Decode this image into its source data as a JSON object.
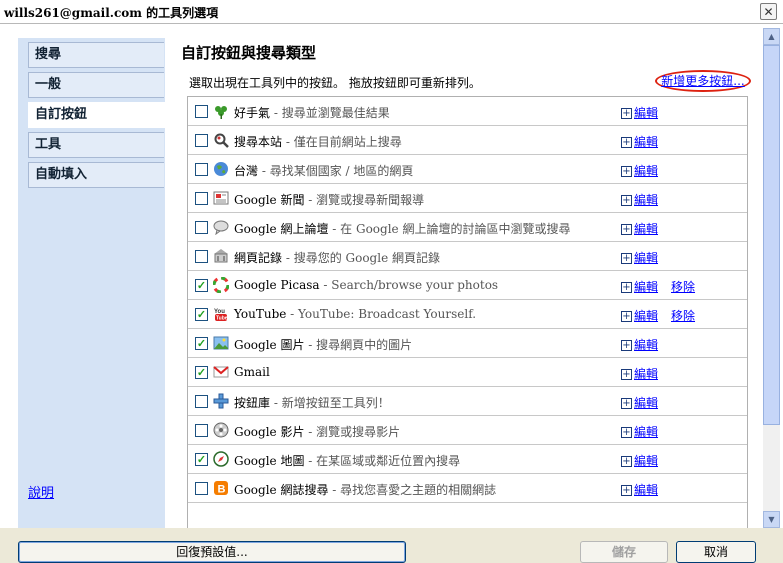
{
  "window": {
    "title": "wills261@gmail.com 的工具列選項",
    "close_glyph": "✕"
  },
  "sidebar": {
    "items": [
      {
        "label": "搜尋"
      },
      {
        "label": "一般"
      },
      {
        "label": "自訂按鈕"
      },
      {
        "label": "工具"
      },
      {
        "label": "自動填入"
      }
    ],
    "active_index": 2,
    "help_label": "說明"
  },
  "main": {
    "heading": "自訂按鈕與搜尋類型",
    "instruction": "選取出現在工具列中的按鈕。 拖放按鈕即可重新排列。",
    "add_more_label": "新增更多按鈕...",
    "edit_label": "編輯",
    "remove_label": "移除",
    "buttons": [
      {
        "name": "好手氣",
        "desc": "搜尋並瀏覽最佳結果",
        "checked": false,
        "icon": "clover-icon",
        "removable": false
      },
      {
        "name": "搜尋本站",
        "desc": "僅在目前網站上搜尋",
        "checked": false,
        "icon": "magnifier-icon",
        "removable": false
      },
      {
        "name": "台灣",
        "desc": "尋找某個國家 / 地區的網頁",
        "checked": false,
        "icon": "globe-icon",
        "removable": false
      },
      {
        "name": "Google 新聞",
        "desc": "瀏覽或搜尋新聞報導",
        "checked": false,
        "icon": "newspaper-icon",
        "removable": false
      },
      {
        "name": "Google 網上論壇",
        "desc": "在 Google 網上論壇的討論區中瀏覽或搜尋",
        "checked": false,
        "icon": "chat-bubble-icon",
        "removable": false
      },
      {
        "name": "網頁記錄",
        "desc": "搜尋您的 Google 網頁記錄",
        "checked": false,
        "icon": "history-building-icon",
        "removable": false
      },
      {
        "name": "Google Picasa",
        "desc": "Search/browse your photos",
        "checked": true,
        "icon": "picasa-icon",
        "removable": true
      },
      {
        "name": "YouTube",
        "desc": "YouTube: Broadcast Yourself.",
        "checked": true,
        "icon": "youtube-icon",
        "removable": true
      },
      {
        "name": "Google 圖片",
        "desc": "搜尋網頁中的圖片",
        "checked": true,
        "icon": "picture-icon",
        "removable": false
      },
      {
        "name": "Gmail",
        "desc": "",
        "checked": true,
        "icon": "gmail-icon",
        "removable": false
      },
      {
        "name": "按鈕庫",
        "desc": "新增按鈕至工具列！",
        "checked": false,
        "icon": "plus-blue-icon",
        "removable": false
      },
      {
        "name": "Google 影片",
        "desc": "瀏覽或搜尋影片",
        "checked": false,
        "icon": "film-reel-icon",
        "removable": false
      },
      {
        "name": "Google 地圖",
        "desc": "在某區域或鄰近位置內搜尋",
        "checked": true,
        "icon": "compass-icon",
        "removable": false
      },
      {
        "name": "Google 網誌搜尋",
        "desc": "尋找您喜愛之主題的相關網誌",
        "checked": false,
        "icon": "blogger-icon",
        "removable": false
      }
    ],
    "separator": " - "
  },
  "footer": {
    "restore_label": "回復預設值...",
    "save_label": "儲存",
    "cancel_label": "取消"
  },
  "colors": {
    "sidebar_bg": "#d5e3f5",
    "link": "#0000ff",
    "highlight_ring": "#dd2211",
    "check": "#21a121"
  }
}
